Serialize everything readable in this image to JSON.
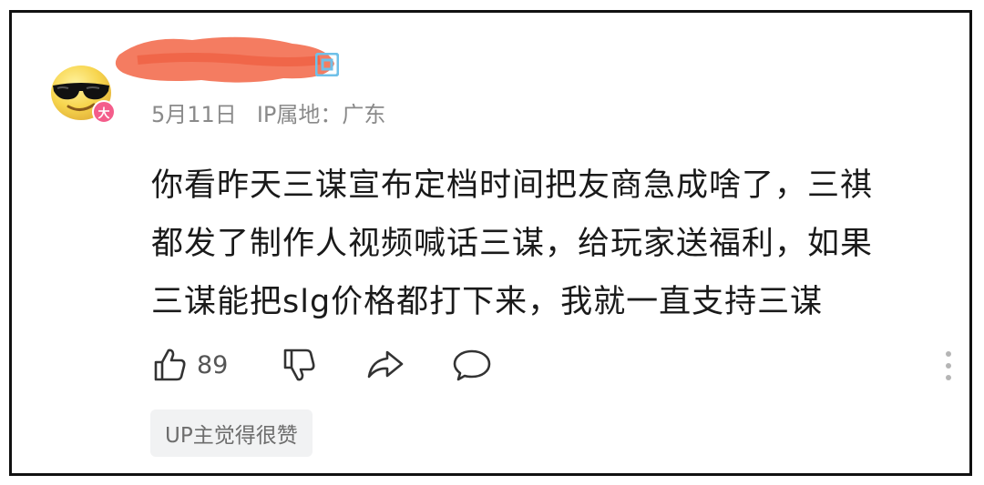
{
  "avatar": {
    "badge_text": "大",
    "badge_color": "#f45d8b",
    "icon": "sunglasses-emoji-icon"
  },
  "meta": {
    "date": "5月11日",
    "ip_location": "IP属地：广东"
  },
  "comment": {
    "lines": [
      "你看昨天三谋宣布定档时间把友商急成啥了，三祺",
      "都发了制作人视频喊话三谋，给玩家送福利，如果",
      "三谋能把slg价格都打下来，我就一直支持三谋"
    ]
  },
  "actions": {
    "like_count": "89",
    "icons": [
      "thumbs-up-icon",
      "thumbs-down-icon",
      "share-icon",
      "comment-icon",
      "more-vertical-icon"
    ]
  },
  "tag": {
    "label": "UP主觉得很赞"
  },
  "colors": {
    "redaction": "#f26a4b",
    "level_icon": "#6fc0e8"
  }
}
